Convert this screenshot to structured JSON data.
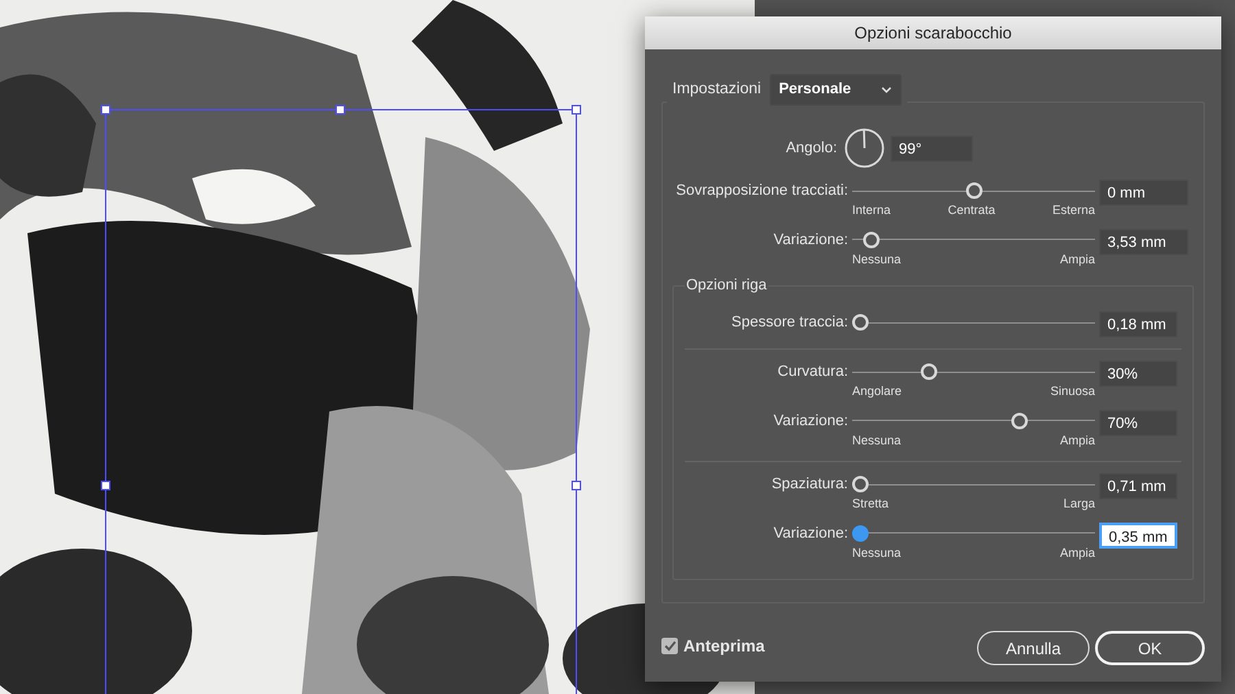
{
  "dialog": {
    "title": "Opzioni scarabocchio"
  },
  "settings": {
    "label": "Impostazioni",
    "value": "Personale"
  },
  "angle": {
    "label": "Angolo:",
    "value": "99°"
  },
  "top_sliders": [
    {
      "label": "Sovrapposizione tracciati:",
      "level": 0.5,
      "value": "0 mm",
      "min_label": "Interna",
      "mid_label": "Centrata",
      "max_label": "Esterna",
      "focused": false
    },
    {
      "label": "Variazione:",
      "level": 0.05,
      "value": "3,53 mm",
      "min_label": "Nessuna",
      "max_label": "Ampia",
      "focused": false
    }
  ],
  "line_options": {
    "title": "Opzioni riga",
    "groups": [
      [
        {
          "label": "Spessore traccia:",
          "level": 0,
          "value": "0,18 mm",
          "focused": false
        }
      ],
      [
        {
          "label": "Curvatura:",
          "level": 0.3,
          "value": "30%",
          "min_label": "Angolare",
          "max_label": "Sinuosa",
          "focused": false
        },
        {
          "label": "Variazione:",
          "level": 0.7,
          "value": "70%",
          "min_label": "Nessuna",
          "max_label": "Ampia",
          "focused": false
        }
      ],
      [
        {
          "label": "Spaziatura:",
          "level": 0,
          "value": "0,71 mm",
          "min_label": "Stretta",
          "max_label": "Larga",
          "focused": false
        },
        {
          "label": "Variazione:",
          "level": 0,
          "value": "0,35 mm",
          "min_label": "Nessuna",
          "max_label": "Ampia",
          "focused": true
        }
      ]
    ]
  },
  "preview": {
    "label": "Anteprima",
    "checked": true
  },
  "buttons": [
    {
      "label": "Annulla",
      "default": false
    },
    {
      "label": "OK",
      "default": true
    }
  ]
}
